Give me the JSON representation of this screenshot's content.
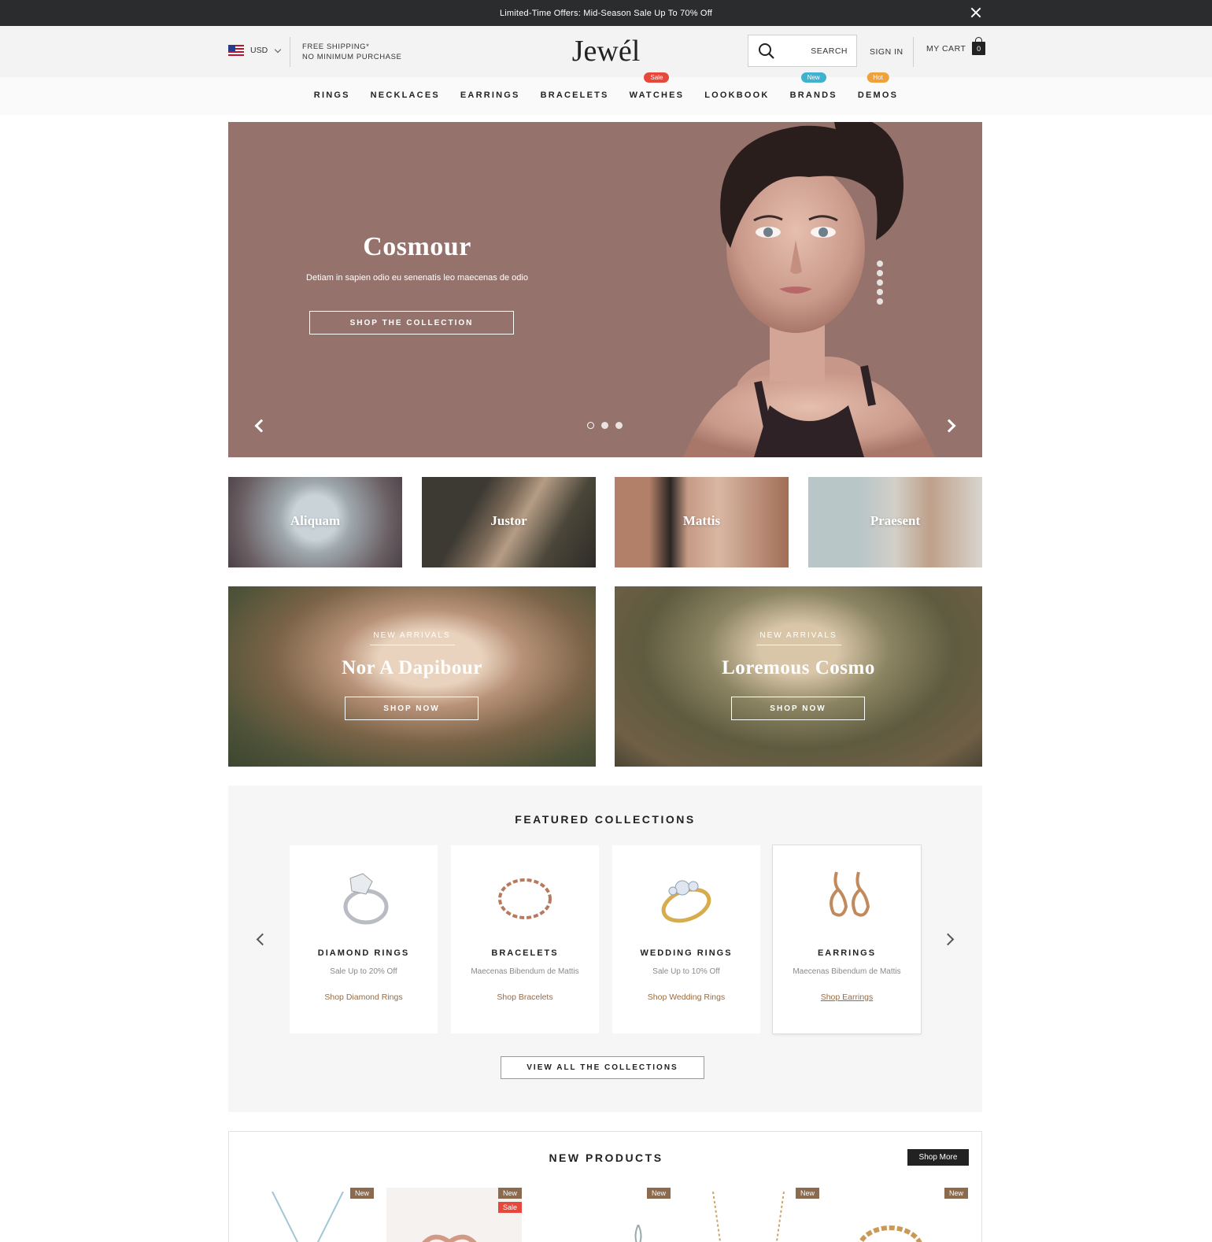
{
  "announcement": {
    "text": "Limited-Time Offers: Mid-Season Sale Up To 70% Off"
  },
  "header": {
    "currency": "USD",
    "shipping_line1": "FREE SHIPPING*",
    "shipping_line2": "NO MINIMUM PURCHASE",
    "logo": "Jewél",
    "search_label": "SEARCH",
    "signin": "SIGN IN",
    "cart_label": "MY CART",
    "cart_count": "0"
  },
  "nav": {
    "items": [
      {
        "label": "RINGS"
      },
      {
        "label": "NECKLACES"
      },
      {
        "label": "EARRINGS"
      },
      {
        "label": "BRACELETS"
      },
      {
        "label": "WATCHES",
        "badge": "Sale"
      },
      {
        "label": "LOOKBOOK"
      },
      {
        "label": "BRANDS",
        "badge": "New"
      },
      {
        "label": "DEMOS",
        "badge": "Hot"
      }
    ]
  },
  "hero": {
    "title": "Cosmour",
    "subtitle": "Detiam in sapien odio eu senenatis leo maecenas de odio",
    "button": "SHOP THE COLLECTION"
  },
  "categories": [
    "Aliquam",
    "Justor",
    "Mattis",
    "Praesent"
  ],
  "promos": [
    {
      "kicker": "NEW ARRIVALS",
      "title": "Nor A Dapibour",
      "button": "SHOP NOW"
    },
    {
      "kicker": "NEW ARRIVALS",
      "title": "Loremous Cosmo",
      "button": "SHOP NOW"
    }
  ],
  "featured": {
    "title": "FEATURED COLLECTIONS",
    "cards": [
      {
        "name": "DIAMOND RINGS",
        "sub": "Sale Up to 20% Off",
        "link": "Shop Diamond Rings"
      },
      {
        "name": "BRACELETS",
        "sub": "Maecenas Bibendum de Mattis",
        "link": "Shop Bracelets"
      },
      {
        "name": "WEDDING RINGS",
        "sub": "Sale Up to 10% Off",
        "link": "Shop Wedding Rings"
      },
      {
        "name": "EARRINGS",
        "sub": "Maecenas Bibendum de Mattis",
        "link": "Shop Earrings"
      }
    ],
    "view_all": "VIEW ALL THE COLLECTIONS"
  },
  "new_products": {
    "title": "NEW PRODUCTS",
    "shop_more": "Shop More",
    "tags": {
      "new": "New",
      "sale": "Sale"
    }
  },
  "colors": {
    "topbar": "#2b2c2e",
    "hero_bg": "#95736c",
    "badge_sale": "#e8483b",
    "badge_new": "#3fb2cf",
    "badge_hot": "#f0a23a",
    "link_accent": "#9a6a3d"
  }
}
